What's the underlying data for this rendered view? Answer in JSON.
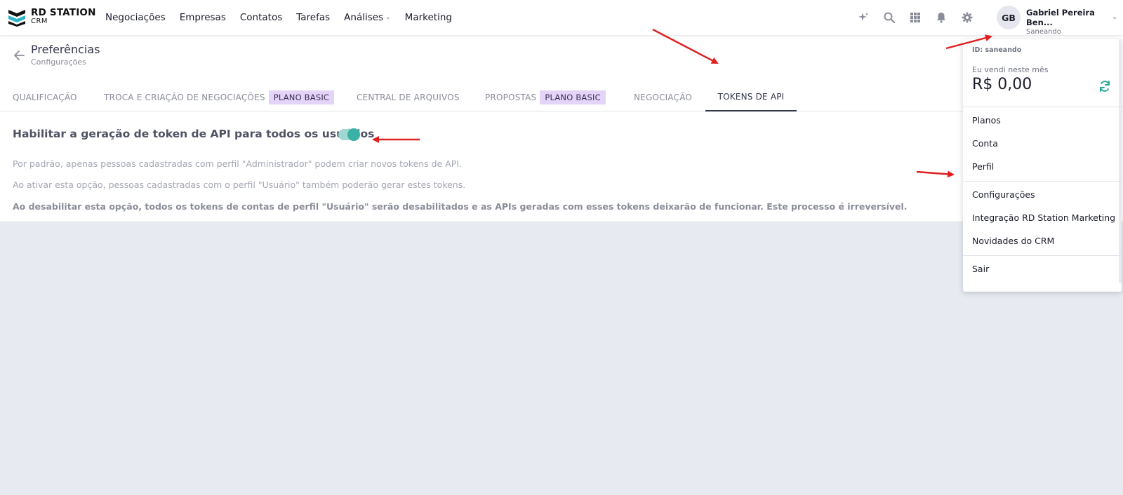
{
  "header": {
    "logo_title": "RD STATION",
    "logo_sub": "CRM",
    "nav": [
      {
        "label": "Negociações",
        "has_chevron": false
      },
      {
        "label": "Empresas",
        "has_chevron": false
      },
      {
        "label": "Contatos",
        "has_chevron": false
      },
      {
        "label": "Tarefas",
        "has_chevron": false
      },
      {
        "label": "Análises",
        "has_chevron": true
      },
      {
        "label": "Marketing",
        "has_chevron": false
      }
    ],
    "icons": [
      "sparkle-icon",
      "search-icon",
      "apps-grid-icon",
      "bell-icon",
      "gear-icon"
    ],
    "avatar_initials": "GB",
    "user_name": "Gabriel Pereira Ben...",
    "user_org": "Saneando"
  },
  "page": {
    "title": "Preferências",
    "subtitle": "Configurações"
  },
  "tabs": [
    {
      "label": "QUALIFICAÇÃO",
      "badge": null,
      "active": false
    },
    {
      "label": "TROCA E CRIAÇÃO DE NEGOCIAÇÕES",
      "badge": "PLANO BASIC",
      "active": false
    },
    {
      "label": "CENTRAL DE ARQUIVOS",
      "badge": null,
      "active": false
    },
    {
      "label": "PROPOSTAS",
      "badge": "PLANO BASIC",
      "active": false
    },
    {
      "label": "NEGOCIAÇÃO",
      "badge": null,
      "active": false
    },
    {
      "label": "TOKENS DE API",
      "badge": null,
      "active": true
    }
  ],
  "setting": {
    "title": "Habilitar a geração de token de API para todos os usuários",
    "enabled": true,
    "desc1": "Por padrão, apenas pessoas cadastradas com perfil \"Administrador\" podem criar novos tokens de API.",
    "desc2": "Ao ativar esta opção, pessoas cadastradas com o perfil \"Usuário\" também poderão gerar estes tokens.",
    "desc3": "Ao desabilitar esta opção, todos os tokens de contas de perfil \"Usuário\" serão desabilitados e as APIs geradas com esses tokens deixarão de funcionar. Este processo é irreversível."
  },
  "dropdown": {
    "id_label": "ID: saneando",
    "sold_label": "Eu vendi neste mês",
    "sold_value": "R$ 0,00",
    "group1": [
      "Planos",
      "Conta",
      "Perfil"
    ],
    "group2": [
      "Configurações",
      "Integração RD Station Marketing",
      "Novidades do CRM"
    ],
    "group3": [
      "Sair"
    ]
  },
  "colors": {
    "accent_teal": "#3ab1a4",
    "badge_purple": "#e4d4f7",
    "annotation_red": "#e02020"
  }
}
